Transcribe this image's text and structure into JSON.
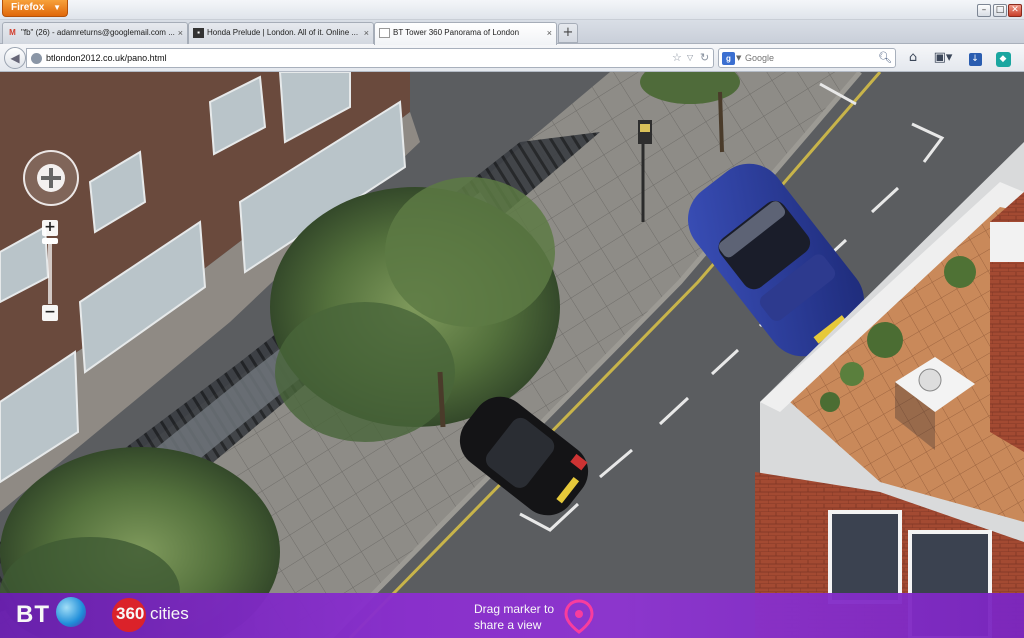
{
  "app": {
    "menu_label": "Firefox"
  },
  "window": {
    "minimize_icon": "minimize-icon",
    "maximize_icon": "maximize-icon",
    "close_icon": "close-icon"
  },
  "tabs": [
    {
      "label": "\"fb\" (26) - adamreturns@googlemail.com ...",
      "favicon": "gmail-icon",
      "active": false
    },
    {
      "label": "Honda Prelude | London. All of it. Online ...",
      "favicon": "page-icon",
      "active": false
    },
    {
      "label": "BT Tower 360 Panorama of London",
      "favicon": "blank-page-icon",
      "active": true
    }
  ],
  "navbar": {
    "url": "btlondon2012.co.uk/pano.html",
    "search_placeholder": "Google",
    "search_engine_letter": "g"
  },
  "viewer": {
    "zoom_in_label": "+",
    "zoom_out_label": "−",
    "zoom_level": 0.0
  },
  "branding": {
    "bt_logo": "BT",
    "cities_number": "360",
    "cities_text": "cities",
    "drag_hint": "Drag marker to share a view"
  },
  "colors": {
    "bar_accent": "#8b2fd0",
    "marker": "#ff3ca0",
    "cities_red": "#e2202a"
  }
}
